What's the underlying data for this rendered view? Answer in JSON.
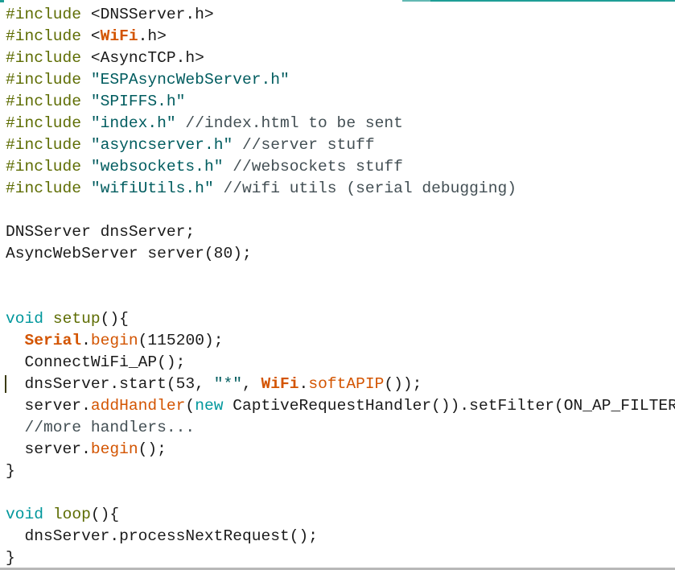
{
  "editor": {
    "language": "Arduino C++",
    "colors": {
      "preprocessor": "#5e6d03",
      "keyword": "#00979c",
      "function_name": "#5e6d03",
      "class_builtin": "#d35400",
      "method_builtin": "#d35400",
      "string": "#005c5f",
      "comment": "#434f54",
      "default_text": "#1a1a1a",
      "accent_strip": "#1e9e96"
    },
    "caret_line": 18,
    "lines": [
      [
        {
          "t": "pp",
          "v": "#include"
        },
        {
          "t": "tx",
          "v": " <DNSServer.h>"
        }
      ],
      [
        {
          "t": "pp",
          "v": "#include"
        },
        {
          "t": "tx",
          "v": " <"
        },
        {
          "t": "cls",
          "v": "WiFi"
        },
        {
          "t": "tx",
          "v": ".h>"
        }
      ],
      [
        {
          "t": "pp",
          "v": "#include"
        },
        {
          "t": "tx",
          "v": " <AsyncTCP.h>"
        }
      ],
      [
        {
          "t": "pp",
          "v": "#include"
        },
        {
          "t": "tx",
          "v": " "
        },
        {
          "t": "str",
          "v": "\"ESPAsyncWebServer.h\""
        }
      ],
      [
        {
          "t": "pp",
          "v": "#include"
        },
        {
          "t": "tx",
          "v": " "
        },
        {
          "t": "str",
          "v": "\"SPIFFS.h\""
        }
      ],
      [
        {
          "t": "pp",
          "v": "#include"
        },
        {
          "t": "tx",
          "v": " "
        },
        {
          "t": "str",
          "v": "\"index.h\""
        },
        {
          "t": "cmt",
          "v": " //index.html to be sent"
        }
      ],
      [
        {
          "t": "pp",
          "v": "#include"
        },
        {
          "t": "tx",
          "v": " "
        },
        {
          "t": "str",
          "v": "\"asyncserver.h\""
        },
        {
          "t": "cmt",
          "v": " //server stuff"
        }
      ],
      [
        {
          "t": "pp",
          "v": "#include"
        },
        {
          "t": "tx",
          "v": " "
        },
        {
          "t": "str",
          "v": "\"websockets.h\""
        },
        {
          "t": "cmt",
          "v": " //websockets stuff"
        }
      ],
      [
        {
          "t": "pp",
          "v": "#include"
        },
        {
          "t": "tx",
          "v": " "
        },
        {
          "t": "str",
          "v": "\"wifiUtils.h\""
        },
        {
          "t": "cmt",
          "v": " //wifi utils (serial debugging)"
        }
      ],
      [],
      [
        {
          "t": "tx",
          "v": "DNSServer dnsServer;"
        }
      ],
      [
        {
          "t": "tx",
          "v": "AsyncWebServer server(80);"
        }
      ],
      [],
      [],
      [
        {
          "t": "kw",
          "v": "void"
        },
        {
          "t": "tx",
          "v": " "
        },
        {
          "t": "fn",
          "v": "setup"
        },
        {
          "t": "tx",
          "v": "(){"
        }
      ],
      [
        {
          "t": "tx",
          "v": "  "
        },
        {
          "t": "cls",
          "v": "Serial"
        },
        {
          "t": "tx",
          "v": "."
        },
        {
          "t": "mth",
          "v": "begin"
        },
        {
          "t": "tx",
          "v": "(115200);"
        }
      ],
      [
        {
          "t": "tx",
          "v": "  ConnectWiFi_AP();"
        }
      ],
      [
        {
          "t": "tx",
          "v": "  dnsServer.start(53, "
        },
        {
          "t": "str",
          "v": "\"*\""
        },
        {
          "t": "tx",
          "v": ", "
        },
        {
          "t": "cls",
          "v": "WiFi"
        },
        {
          "t": "tx",
          "v": "."
        },
        {
          "t": "mth",
          "v": "softAPIP"
        },
        {
          "t": "tx",
          "v": "());"
        }
      ],
      [
        {
          "t": "tx",
          "v": "  server."
        },
        {
          "t": "mth",
          "v": "addHandler"
        },
        {
          "t": "tx",
          "v": "("
        },
        {
          "t": "kw",
          "v": "new"
        },
        {
          "t": "tx",
          "v": " CaptiveRequestHandler()).setFilter(ON_AP_FILTER);"
        }
      ],
      [
        {
          "t": "cmt",
          "v": "  //more handlers..."
        }
      ],
      [
        {
          "t": "tx",
          "v": "  server."
        },
        {
          "t": "mth",
          "v": "begin"
        },
        {
          "t": "tx",
          "v": "();"
        }
      ],
      [
        {
          "t": "tx",
          "v": "}"
        }
      ],
      [],
      [
        {
          "t": "kw",
          "v": "void"
        },
        {
          "t": "tx",
          "v": " "
        },
        {
          "t": "fn",
          "v": "loop"
        },
        {
          "t": "tx",
          "v": "(){"
        }
      ],
      [
        {
          "t": "tx",
          "v": "  dnsServer.processNextRequest();"
        }
      ],
      [
        {
          "t": "tx",
          "v": "}"
        }
      ]
    ]
  }
}
